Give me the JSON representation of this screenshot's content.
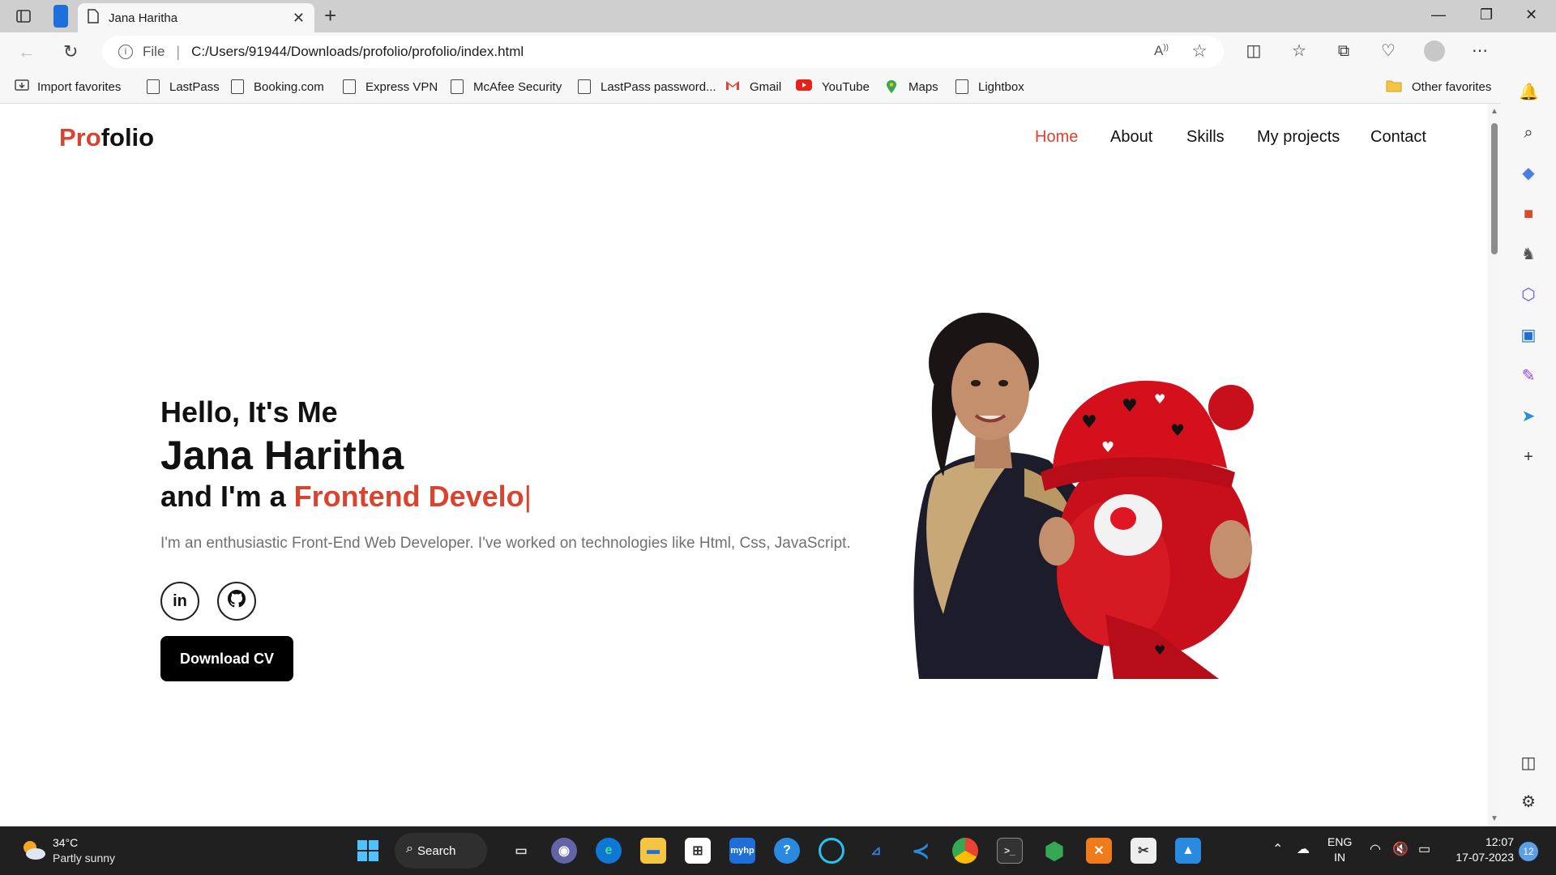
{
  "browser": {
    "tab_title": "Jana Haritha",
    "address": {
      "scheme_label": "File",
      "url": "C:/Users/91944/Downloads/profolio/profolio/index.html"
    },
    "bookmarks": [
      {
        "label": "Import favorites",
        "icon": "import-icon"
      },
      {
        "label": "LastPass",
        "icon": "page-icon"
      },
      {
        "label": "Booking.com",
        "icon": "page-icon"
      },
      {
        "label": "Express VPN",
        "icon": "page-icon"
      },
      {
        "label": "McAfee Security",
        "icon": "page-icon"
      },
      {
        "label": "LastPass password...",
        "icon": "page-icon"
      },
      {
        "label": "Gmail",
        "icon": "gmail-icon"
      },
      {
        "label": "YouTube",
        "icon": "youtube-icon"
      },
      {
        "label": "Maps",
        "icon": "maps-icon"
      },
      {
        "label": "Lightbox",
        "icon": "page-icon"
      }
    ],
    "other_favorites": "Other favorites"
  },
  "site": {
    "logo": {
      "accent": "Pro",
      "rest": "folio"
    },
    "nav": [
      "Home",
      "About",
      "Skills",
      "My projects",
      "Contact"
    ],
    "active_nav": "Home",
    "hero": {
      "greeting": "Hello, It's Me",
      "name": "Jana Haritha",
      "role_prefix": "and I'm a",
      "role_typed": "Frontend Develo",
      "caret": "|",
      "intro": "I'm an enthusiastic Front-End Web Developer. I've worked on technologies like Html, Css, JavaScript.",
      "social": [
        {
          "label": "in",
          "icon": "linkedin-icon"
        },
        {
          "label": "",
          "icon": "github-icon"
        }
      ],
      "cta": "Download CV"
    },
    "accent_color": "#d9432f"
  },
  "taskbar": {
    "weather": {
      "temp": "34°C",
      "desc": "Partly sunny"
    },
    "search_label": "Search",
    "tray": {
      "lang_line1": "ENG",
      "lang_line2": "IN",
      "time": "12:07",
      "date": "17-07-2023",
      "notifications": "12"
    }
  }
}
